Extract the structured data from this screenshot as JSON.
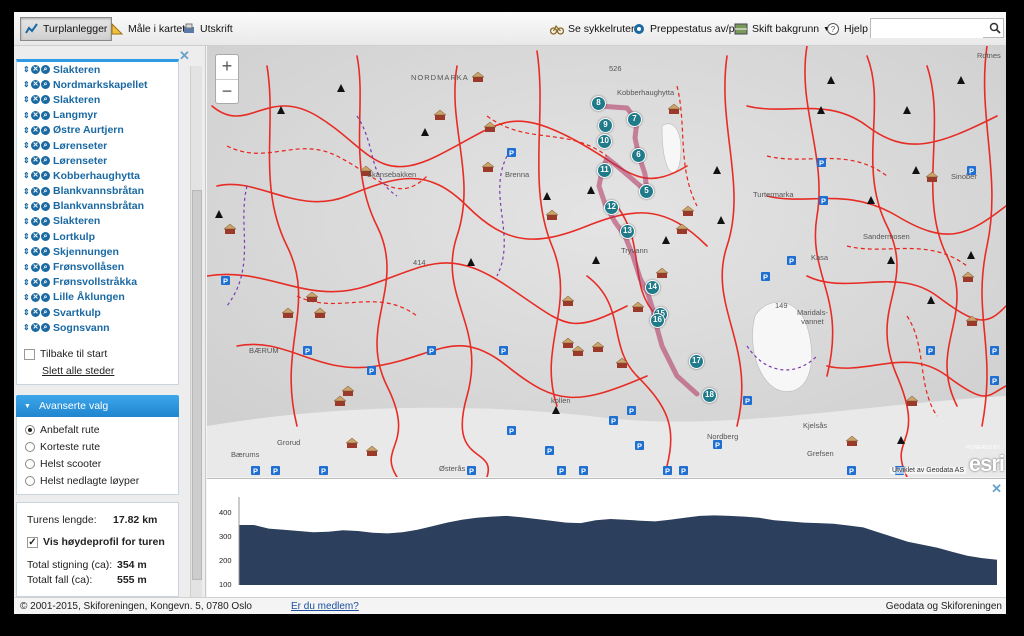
{
  "toolbar": {
    "route_planner": "Turplanlegger",
    "measure": "Måle i kartet",
    "print": "Utskrift",
    "bike_routes": "Se sykkelruter",
    "grooming_status": "Preppestatus av/på",
    "change_background": "Skift bakgrunn",
    "help": "Hjelp",
    "search_placeholder": ""
  },
  "places": [
    "Slakteren",
    "Nordmarkskapellet",
    "Slakteren",
    "Langmyr",
    "Østre Aurtjern",
    "Lørenseter",
    "Lørenseter",
    "Kobberhaughytta",
    "Blankvannsbråtan",
    "Blankvannsbråtan",
    "Slakteren",
    "Lortkulp",
    "Skjennungen",
    "Frønsvollåsen",
    "Frønsvollstråkka",
    "Lille Åklungen",
    "Svartkulp",
    "Sognsvann"
  ],
  "back_to_start": "Tilbake til start",
  "clear_all": "Slett alle steder",
  "advanced": {
    "header": "Avanserte valg",
    "options": [
      "Anbefalt rute",
      "Korteste rute",
      "Helst scooter",
      "Helst nedlagte løyper"
    ],
    "selected_index": 0
  },
  "stats": {
    "length_label": "Turens lengde:",
    "length_value": "17.82 km",
    "show_profile_label": "Vis høydeprofil for turen",
    "show_profile_checked": true,
    "ascent_label": "Total stigning (ca):",
    "ascent_value": "354 m",
    "descent_label": "Totalt fall (ca):",
    "descent_value": "555 m"
  },
  "map": {
    "labels": {
      "nordmarka": "NORDMARKA",
      "kobberhaughytta": "Kobberhaughytta",
      "skansebakken": "Skansebakken",
      "brenna": "Brenna",
      "tryvann": "Tryvann",
      "maridalsvannet": "Maridals-\nvannet",
      "baerum": "BÆRUM",
      "nordberg": "Nordberg",
      "kjelsas": "Kjelsås",
      "grefsen": "Grefsen",
      "osteras": "Østerås",
      "kasa": "Kasa",
      "sandermosen": "Sandermosen",
      "rotnes": "Rotnes",
      "sinober": "Sinober",
      "turtermarka": "Turtermarka",
      "grorud": "Grorud",
      "baerums": "Bærums",
      "vettakollen": "kollen",
      "elev_414": "414",
      "elev_149": "149",
      "elev_526": "526"
    },
    "route_numbers": [
      "5",
      "6",
      "7",
      "8",
      "9",
      "10",
      "11",
      "12",
      "13",
      "14",
      "15",
      "16",
      "17",
      "18"
    ],
    "attribution": "Utviklet av Geodata AS",
    "esri": "esri",
    "powered": "POWERED BY"
  },
  "elevation": {
    "y_ticks": [
      "400",
      "300",
      "200",
      "100"
    ],
    "profile_m": [
      350,
      350,
      335,
      330,
      325,
      320,
      322,
      328,
      325,
      318,
      315,
      320,
      330,
      345,
      360,
      372,
      380,
      385,
      388,
      382,
      375,
      368,
      360,
      358,
      370,
      375,
      372,
      368,
      365,
      372,
      380,
      388,
      390,
      388,
      385,
      380,
      370,
      365,
      360,
      358,
      355,
      348,
      340,
      320,
      300,
      280,
      268,
      255,
      238,
      222,
      212,
      205
    ],
    "y_range": [
      100,
      450
    ]
  },
  "footer": {
    "copyright": "© 2001-2015, Skiforeningen, Kongevn. 5, 0780 Oslo",
    "member_link": "Er du medlem?",
    "right": "Geodata og Skiforeningen"
  },
  "colors": {
    "accent_blue": "#1f86cf",
    "trail_red": "#e8231c",
    "route_purple": "#b0305c",
    "marker_teal": "#1f7a8a",
    "profile_fill": "#2c3f5c"
  }
}
